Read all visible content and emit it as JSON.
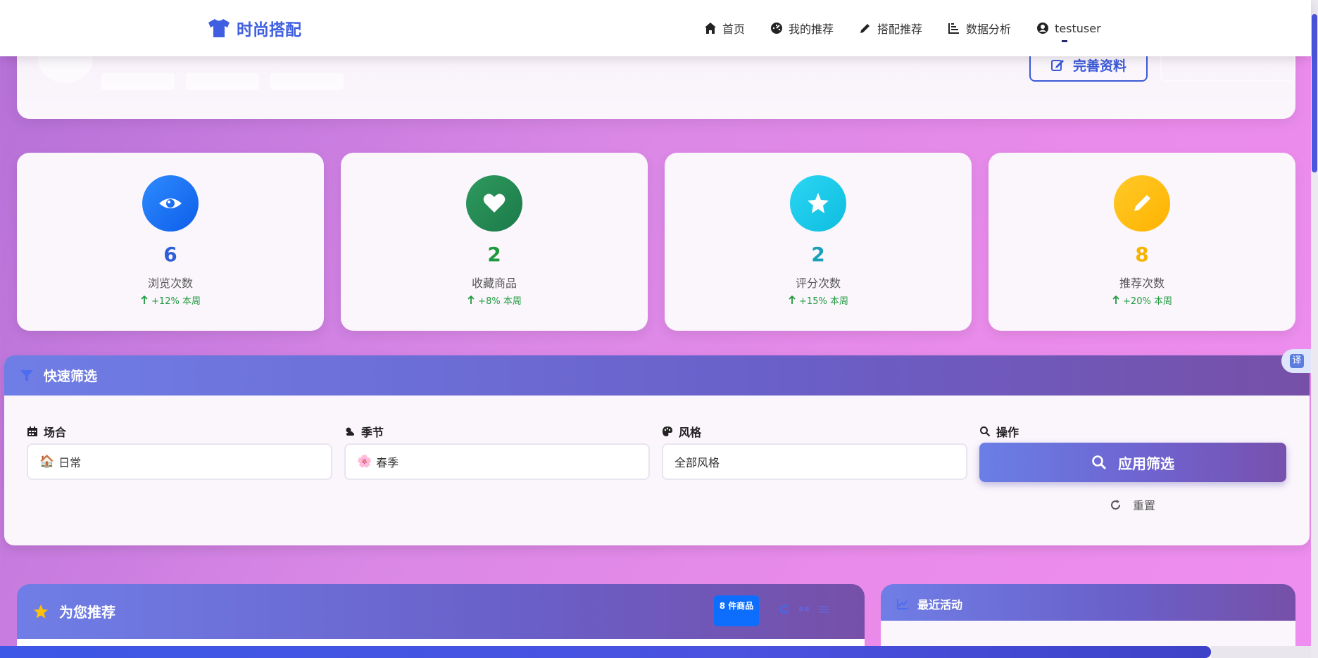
{
  "brand": {
    "name": "时尚搭配"
  },
  "nav": {
    "home": "首页",
    "my_recommend": "我的推荐",
    "outfit": "搭配推荐",
    "analytics": "数据分析",
    "user": "testuser"
  },
  "profile": {
    "complete_button": "完善资料"
  },
  "stats": [
    {
      "value": "6",
      "label": "浏览次数",
      "trend": "+12% 本周",
      "color": "#0d6efd",
      "icon": "eye-icon"
    },
    {
      "value": "2",
      "label": "收藏商品",
      "trend": "+8% 本周",
      "color": "#198754",
      "icon": "heart-icon"
    },
    {
      "value": "2",
      "label": "评分次数",
      "trend": "+15% 本周",
      "color": "#0dcaf0",
      "icon": "star-icon"
    },
    {
      "value": "8",
      "label": "推荐次数",
      "trend": "+20% 本周",
      "color": "#ffc107",
      "icon": "pencil-icon"
    }
  ],
  "filter": {
    "title": "快速筛选",
    "occasion_label": "场合",
    "occasion_value": "日常",
    "season_label": "季节",
    "season_value": "春季",
    "style_label": "风格",
    "style_value": "全部风格",
    "action_label": "操作",
    "apply": "应用筛选",
    "reset": "重置"
  },
  "translate": {
    "label": "译"
  },
  "recommend": {
    "title": "为您推荐",
    "badge": "8 件商品"
  },
  "activity": {
    "title": "最近活动"
  }
}
